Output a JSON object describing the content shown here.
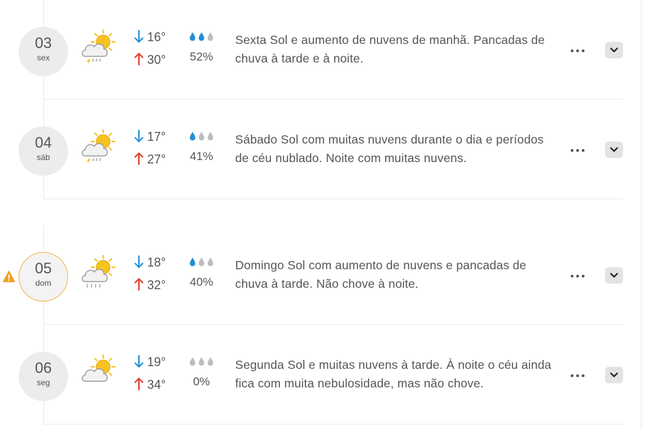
{
  "forecast": [
    {
      "day_num": "03",
      "day_name": "sex",
      "weather_icon": "sun-cloud-thunder-icon",
      "min_temp": "16°",
      "max_temp": "30°",
      "rain_level": 2,
      "rain_pct": "52%",
      "description": "Sexta Sol e aumento de nuvens de manhã. Pancadas de chuva à tarde e à noite.",
      "alert": false
    },
    {
      "day_num": "04",
      "day_name": "sáb",
      "weather_icon": "sun-cloud-thunder-icon",
      "min_temp": "17°",
      "max_temp": "27°",
      "rain_level": 1,
      "rain_pct": "41%",
      "description": "Sábado Sol com muitas nuvens durante o dia e períodos de céu nublado. Noite com muitas nuvens.",
      "alert": false
    },
    {
      "day_num": "05",
      "day_name": "dom",
      "weather_icon": "sun-cloud-rain-icon",
      "min_temp": "18°",
      "max_temp": "32°",
      "rain_level": 1,
      "rain_pct": "40%",
      "description": "Domingo Sol com aumento de nuvens e pancadas de chuva à tarde. Não chove à noite.",
      "alert": true
    },
    {
      "day_num": "06",
      "day_name": "seg",
      "weather_icon": "sun-cloud-icon",
      "min_temp": "19°",
      "max_temp": "34°",
      "rain_level": 0,
      "rain_pct": "0%",
      "description": "Segunda Sol e muitas nuvens à tarde. À noite o céu ainda fica com muita nebulosidade, mas não chove.",
      "alert": false
    }
  ],
  "colors": {
    "arrow_down": "#1f8fd6",
    "arrow_up": "#e03a2a",
    "drop_active": "#1f8fd6",
    "drop_inactive": "#bdbdbd",
    "sun": "#f7c31f",
    "alert": "#f0a020"
  }
}
